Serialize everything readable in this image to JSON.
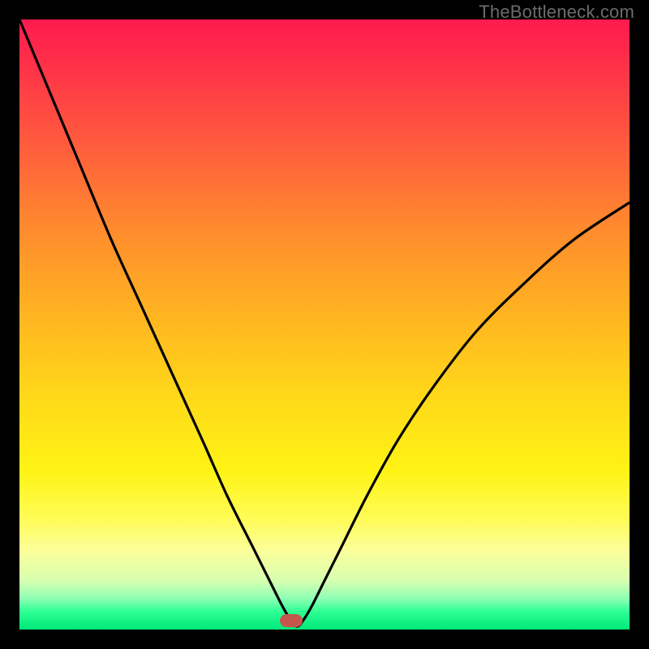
{
  "watermark": "TheBottleneck.com",
  "colors": {
    "frame": "#000000",
    "curve": "#000000",
    "marker": "#c5564d",
    "gradient_top": "#ff1a4f",
    "gradient_bottom": "#00e879"
  },
  "chart_data": {
    "type": "line",
    "title": "",
    "xlabel": "",
    "ylabel": "",
    "xlim": [
      0,
      100
    ],
    "ylim": [
      0,
      100
    ],
    "x": [
      0,
      5,
      10,
      15,
      20,
      25,
      30,
      34,
      38,
      41,
      43,
      44.5,
      45.5,
      46.5,
      48,
      50,
      53,
      57,
      62,
      68,
      75,
      83,
      91,
      100
    ],
    "y": [
      100,
      88,
      76,
      64,
      53,
      42,
      31,
      22,
      14,
      8,
      4,
      1.5,
      0.5,
      1.5,
      4,
      8,
      14,
      22,
      31,
      40,
      49,
      57,
      64,
      70
    ],
    "marker": {
      "x": 44.5,
      "y": 1.5
    },
    "notes": "Axes are unlabeled; values normalized 0-100 by visual estimation. Curve is a V-shaped bottleneck curve with minimum near x≈44.5."
  }
}
